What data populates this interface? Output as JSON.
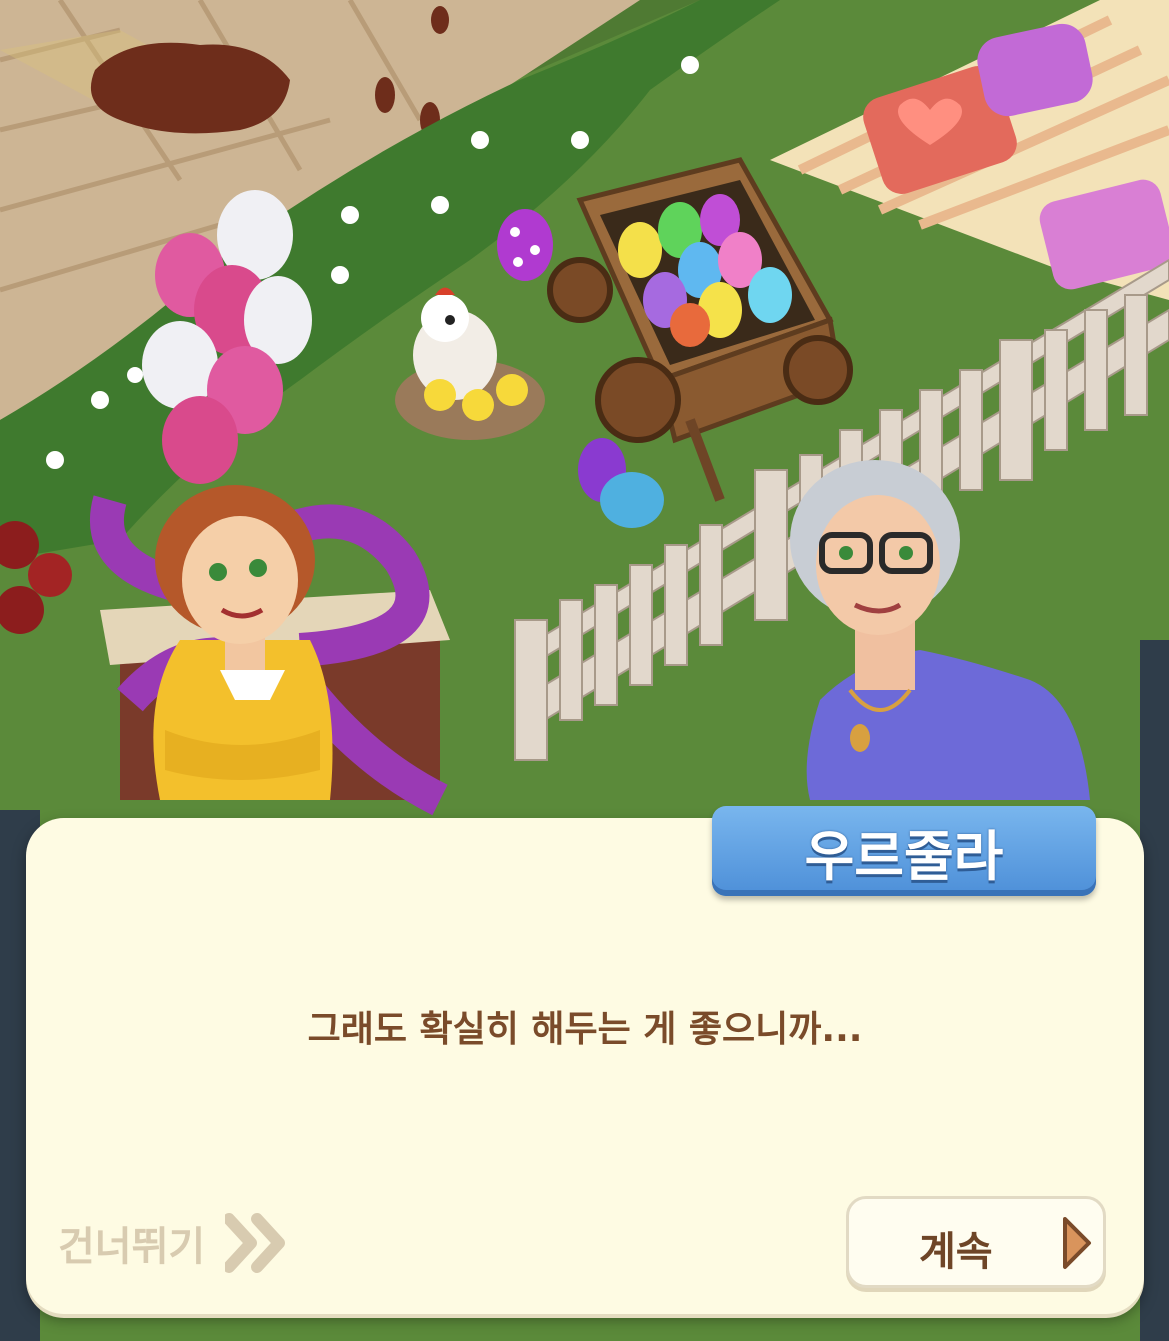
{
  "dialog": {
    "speaker": "우르줄라",
    "line": "그래도 확실히 해두는 게 좋으니까..."
  },
  "controls": {
    "skip_label": "건너뛰기",
    "continue_label": "계속"
  },
  "icons": {
    "skip": "double-chevron-right-icon",
    "continue": "play-triangle-icon"
  },
  "colors": {
    "dialog_bg": "#fefbe3",
    "name_tag": "#5c9ee0",
    "text_brown": "#7a4b2a",
    "skip_text": "#d8cbb0",
    "continue_icon": "#d9945c"
  }
}
